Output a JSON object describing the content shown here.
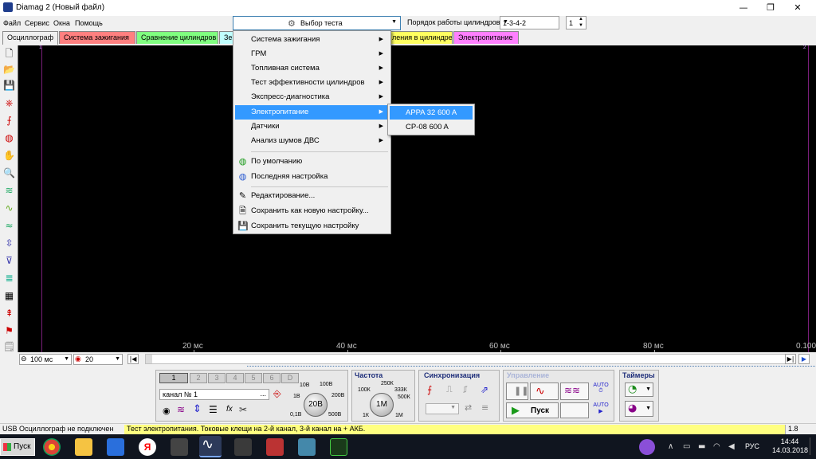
{
  "window": {
    "title": "Diamag 2 (Новый файл)",
    "minimize": "—",
    "maximize": "❐",
    "close": "✕"
  },
  "menu": [
    "Файл",
    "Сервис",
    "Окна",
    "Помощь"
  ],
  "toolbar": {
    "test_select": "Выбор теста",
    "cyl_order_label": "Порядок работы цилиндров",
    "cyl_order_value": "1-3-4-2",
    "cyl_num_value": "1"
  },
  "tabs": [
    {
      "label": "Осциллограф",
      "color": "#f0f0f0"
    },
    {
      "label": "Система зажигания",
      "color": "#ff8080"
    },
    {
      "label": "Сравнение цилиндров",
      "color": "#80ff80"
    },
    {
      "label": "Зе",
      "color": "#c0ffff"
    },
    {
      "label": "ления в цилиндре",
      "color": "#ffff60"
    },
    {
      "label": "Электропитание",
      "color": "#ff80ff"
    }
  ],
  "scope": {
    "background": "#000000",
    "marker_color": "#7a1f7a",
    "marker_left_label": "1",
    "marker_right_label": "2",
    "x_labels": [
      "20 мс",
      "40 мс",
      "60 мс",
      "80 мс",
      "0.100"
    ]
  },
  "scope_controls": {
    "timebase": "100  мс",
    "trigger": "20"
  },
  "dropdown": {
    "items": [
      {
        "label": "Система зажигания",
        "submenu": true
      },
      {
        "label": "ГРМ",
        "submenu": true
      },
      {
        "label": "Топливная система",
        "submenu": true
      },
      {
        "label": "Тест эффективности цилиндров",
        "submenu": true
      },
      {
        "label": "Экспресс-диагностика",
        "submenu": true
      },
      {
        "label": "Электропитание",
        "submenu": true,
        "highlighted": true
      },
      {
        "label": "Датчики",
        "submenu": true
      },
      {
        "label": "Анализ шумов ДВС",
        "submenu": true
      }
    ],
    "settings": [
      {
        "label": "По умолчанию",
        "icon": "default-icon"
      },
      {
        "label": "Последняя настройка",
        "icon": "last-settings-icon"
      }
    ],
    "actions": [
      {
        "label": "Редактирование...",
        "icon": "edit-icon"
      },
      {
        "label": "Сохранить как новую настройку...",
        "icon": "save-as-icon"
      },
      {
        "label": "Сохранить текущую настройку",
        "icon": "save-icon"
      }
    ],
    "highlight_color": "#3399ff"
  },
  "submenu": {
    "items": [
      {
        "label": "APPA 32 600 A",
        "highlighted": true
      },
      {
        "label": "CP-08 600 A",
        "highlighted": false
      }
    ]
  },
  "channels": {
    "buttons": [
      "1",
      "2",
      "3",
      "4",
      "5",
      "6",
      "D"
    ],
    "active": "1",
    "channel_name": "канал № 1",
    "dots": "...",
    "knob_value": "20В",
    "knob_labels": [
      "10В",
      "100В",
      "1В",
      "200В",
      "0,1В",
      "500В"
    ]
  },
  "frequency": {
    "title": "Частота",
    "knob_value": "1М",
    "knob_labels": [
      "250К",
      "100К",
      "333К",
      "500К",
      "1К",
      "1М"
    ]
  },
  "sync": {
    "title": "Синхронизация"
  },
  "control": {
    "title": "Управление",
    "run_label": "Пуск"
  },
  "timers": {
    "title": "Таймеры"
  },
  "status": {
    "left": "USB Осциллограф не подключен",
    "hint": "Тест электропитания. Токовые клещи на 2-й канал, 3-й канал на + АКБ.",
    "hint_bg": "#ffff80",
    "version": "1.8"
  },
  "taskbar": {
    "start": "Пуск",
    "lang": "РУС",
    "time": "14:44",
    "date": "14.03.2018"
  }
}
